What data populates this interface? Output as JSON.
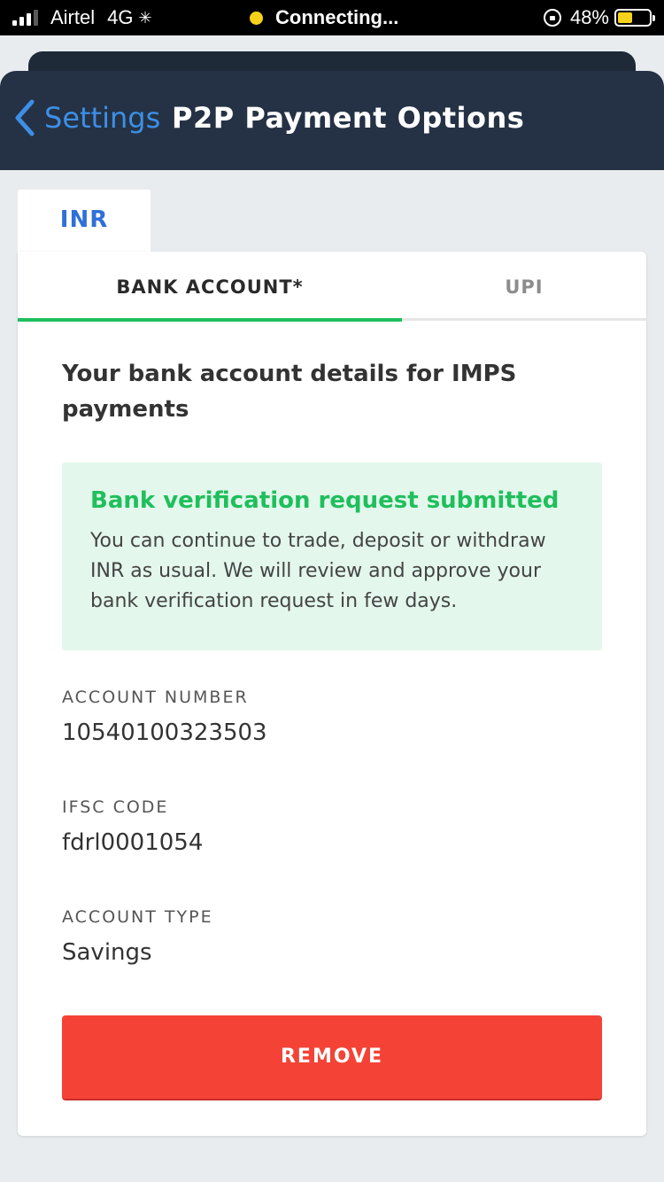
{
  "status_bar": {
    "carrier": "Airtel",
    "network": "4G",
    "center_text": "Connecting...",
    "battery": "48%",
    "battery_level": 0.48
  },
  "header": {
    "back_label": "Settings",
    "title": "P2P Payment Options"
  },
  "currency_tab": "INR",
  "tabs": {
    "bank": "BANK ACCOUNT*",
    "upi": "UPI"
  },
  "section_title": "Your bank account details for IMPS payments",
  "notice": {
    "title": "Bank verification request submitted",
    "body": "You can continue to trade, deposit or withdraw INR as usual. We will review and approve your bank verification request in few days."
  },
  "fields": [
    {
      "label": "ACCOUNT NUMBER",
      "value": "10540100323503"
    },
    {
      "label": "IFSC CODE",
      "value": "fdrl0001054"
    },
    {
      "label": "ACCOUNT TYPE",
      "value": "Savings"
    }
  ],
  "remove_label": "REMOVE",
  "colors": {
    "accent_green": "#1fbf5c",
    "link_blue": "#3d8fe6",
    "danger_red": "#f44336",
    "header_bg": "#253245"
  }
}
